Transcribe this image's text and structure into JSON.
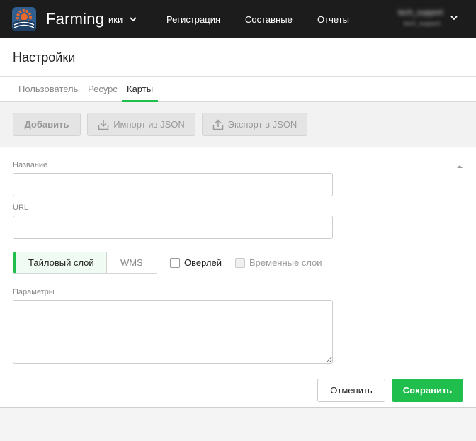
{
  "navbar": {
    "app_title": "Farming",
    "menu_partial": "ики",
    "items": [
      "Регистрация",
      "Составные",
      "Отчеты"
    ],
    "user": {
      "name": "tech_support",
      "email": "tech_support"
    }
  },
  "page": {
    "title": "Настройки"
  },
  "tabs": [
    {
      "label": "Пользователь",
      "active": false
    },
    {
      "label": "Ресурс",
      "active": false
    },
    {
      "label": "Карты",
      "active": true
    }
  ],
  "toolbar": {
    "add_label": "Добавить",
    "import_label": "Импорт из JSON",
    "export_label": "Экспорт в JSON"
  },
  "form": {
    "name_label": "Название",
    "name_value": "",
    "url_label": "URL",
    "url_value": "",
    "layer_type": {
      "options": [
        "Тайловый слой",
        "WMS"
      ],
      "selected": "Тайловый слой"
    },
    "overlay_label": "Оверлей",
    "overlay_checked": false,
    "temporal_label": "Временные слои",
    "temporal_checked": false,
    "params_label": "Параметры",
    "params_value": "",
    "cancel_label": "Отменить",
    "save_label": "Сохранить"
  },
  "colors": {
    "accent": "#1fbe4d",
    "navbar": "#1c1c1c"
  }
}
